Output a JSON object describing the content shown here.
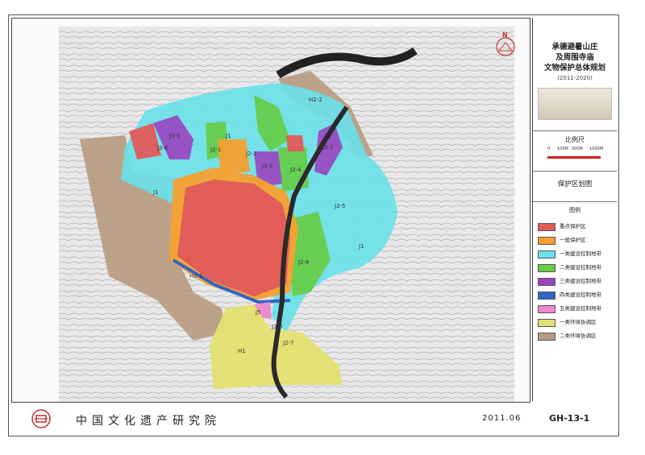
{
  "map": {
    "zone_labels": [
      {
        "id": "J1-a",
        "text": "J1"
      },
      {
        "id": "J1-b",
        "text": "J1"
      },
      {
        "id": "J1-c",
        "text": "J1"
      },
      {
        "id": "J2-1",
        "text": "J2-1"
      },
      {
        "id": "J2-2",
        "text": "J2-2"
      },
      {
        "id": "J2-4",
        "text": "J2-4"
      },
      {
        "id": "J2-5",
        "text": "J2-5"
      },
      {
        "id": "J2-6",
        "text": "J2-6"
      },
      {
        "id": "J2-7",
        "text": "J2-7"
      },
      {
        "id": "J2-8",
        "text": "J2-8"
      },
      {
        "id": "J3-1",
        "text": "J3-1"
      },
      {
        "id": "J3-2",
        "text": "J3-2"
      },
      {
        "id": "J3-5",
        "text": "J3-5"
      },
      {
        "id": "J3-6",
        "text": "J3-6"
      },
      {
        "id": "J5",
        "text": "J5"
      },
      {
        "id": "H2-1",
        "text": "H2-1"
      },
      {
        "id": "H2-2",
        "text": "H2-2"
      },
      {
        "id": "H1",
        "text": "H1"
      }
    ],
    "north_letter": "N"
  },
  "sidebar": {
    "title_lines": [
      "承德避暑山庄",
      "及周围寺庙",
      "文物保护总体规划"
    ],
    "years": "(2011-2020)",
    "scale_label": "比例尺",
    "scale_ticks": [
      "0",
      "100M",
      "500M",
      "1000M"
    ],
    "section_title": "保护区划图",
    "legend_title": "图例",
    "legend": [
      {
        "label": "重点保护区",
        "color": "#e05a5a"
      },
      {
        "label": "一般保护区",
        "color": "#f5a030"
      },
      {
        "label": "一类建设控制地带",
        "color": "#6ae0e8"
      },
      {
        "label": "二类建设控制地带",
        "color": "#66cc44"
      },
      {
        "label": "三类建设控制地带",
        "color": "#9a44c0"
      },
      {
        "label": "四类建设控制地带",
        "color": "#3066c8"
      },
      {
        "label": "五类建设控制地带",
        "color": "#ee88cc"
      },
      {
        "label": "一类环境协调区",
        "color": "#e4e070"
      },
      {
        "label": "二类环境协调区",
        "color": "#b89a80"
      }
    ]
  },
  "footer": {
    "organization": "中国文化遗产研究院",
    "date": "2011.06",
    "drawing_code": "GH-13-1"
  }
}
